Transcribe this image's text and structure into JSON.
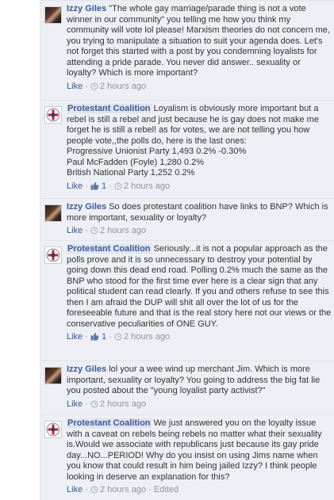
{
  "comments": [
    {
      "author": "Izzy Giles",
      "avatar": "person-photo",
      "text": "\"The whole gay marriage/parade thing is not a vote winner in our community\" you telling me how you think my community will vote lol please! Marxism theories do not concern me, you trying to manipulate a situation to suit your agenda does. Let's not forget this started with a post by you condemning loyalists for attending a pride parade. You never did answer.. sexuality or loyalty? Which is more important?",
      "like_label": "Like",
      "likes": "",
      "time": "2 hours ago",
      "edited": ""
    },
    {
      "author": "Protestant Coalition",
      "avatar": "crest-logo",
      "text": "Loyalism is obviously more important but a rebel is still a rebel and just because he is gay does not make me forget he is still a rebel! as for votes, we are not telling you how people vote,,the polls do, here is the last ones:",
      "extra_lines": [
        "Progressive Unionist Party 1,493 0.2% -0.30%",
        "Paul McFadden (Foyle) 1,280 0.2%",
        "British National Party 1,252 0.2%"
      ],
      "like_label": "Like",
      "likes": "1",
      "time": "2 hours ago",
      "edited": ""
    },
    {
      "author": "Izzy Giles",
      "avatar": "person-photo",
      "text": "So does protestant coalition have links to BNP? Which is more important, sexuality or loyalty?",
      "like_label": "Like",
      "likes": "",
      "time": "2 hours ago",
      "edited": ""
    },
    {
      "author": "Protestant Coalition",
      "avatar": "crest-logo",
      "text": "Seriously...it is not a popular approach as the polls prove and it is so unnecessary to destroy your potential by going down this dead end road. Polling 0.2% much the same as the BNP who stood for the first time ever here is a clear sign that any political student can read clearly. If you and others refuse to see this then I am afraid the DUP will shit all over the lot of us for the foreseeable future and that is the real story here not our views or the conservative peculiarities of ONE GUY.",
      "like_label": "Like",
      "likes": "1",
      "time": "2 hours ago",
      "edited": ""
    },
    {
      "author": "Izzy Giles",
      "avatar": "person-photo",
      "text": "lol your a wee wind up merchant Jim. Which is more important, sexuality or loyalty? You going to address the big fat lie you posted about the \"young loyalist party activist?\"",
      "like_label": "Like",
      "likes": "",
      "time": "2 hours ago",
      "edited": ""
    },
    {
      "author": "Protestant Coalition",
      "avatar": "crest-logo",
      "text": "We just answered you on the loyalty issue with a caveat on rebels being rebels no matter what their sexuality is.Would we associate with republicans just because its gay pride day...NO...PERIOD! Why do you insist on using Jims name when you know that could result in him being jailed Izzy? I think people looking in deserve an explanation for this?",
      "like_label": "Like",
      "likes": "",
      "time": "2 hours ago",
      "edited": "Edited"
    }
  ],
  "colors": {
    "thread_bg": "#edeff4",
    "link": "#3b5998",
    "meta": "#8c94a6",
    "text": "#333333"
  }
}
